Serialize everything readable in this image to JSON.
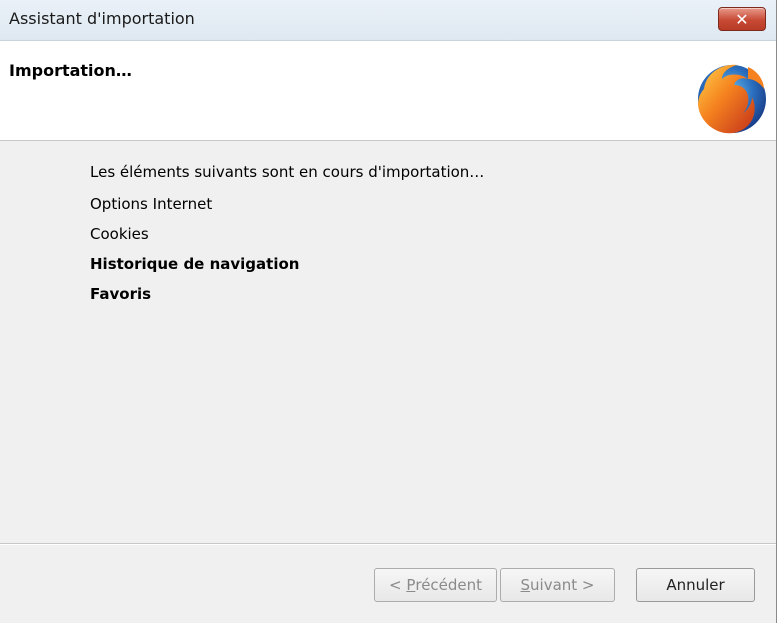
{
  "window": {
    "title": "Assistant d'importation",
    "close_glyph": "✕"
  },
  "header": {
    "title": "Importation…",
    "logo_icon": "firefox-logo-icon"
  },
  "content": {
    "intro": "Les éléments suivants sont en cours d'importation…",
    "items": [
      {
        "label": "Options Internet",
        "state": "done"
      },
      {
        "label": "Cookies",
        "state": "done"
      },
      {
        "label": "Historique de navigation",
        "state": "in-progress"
      },
      {
        "label": "Favoris",
        "state": "in-progress"
      }
    ]
  },
  "footer": {
    "previous": {
      "prefix": "< ",
      "mnemonic": "P",
      "rest": "récédent",
      "enabled": false
    },
    "next": {
      "mnemonic": "S",
      "rest": "uivant >",
      "enabled": false
    },
    "cancel": {
      "label": "Annuler",
      "enabled": true
    }
  },
  "colors": {
    "window_bg": "#f0f0f0",
    "titlebar": "#dfe8f1",
    "close_button": "#c84a35",
    "disabled_text": "#8a8a8a"
  }
}
